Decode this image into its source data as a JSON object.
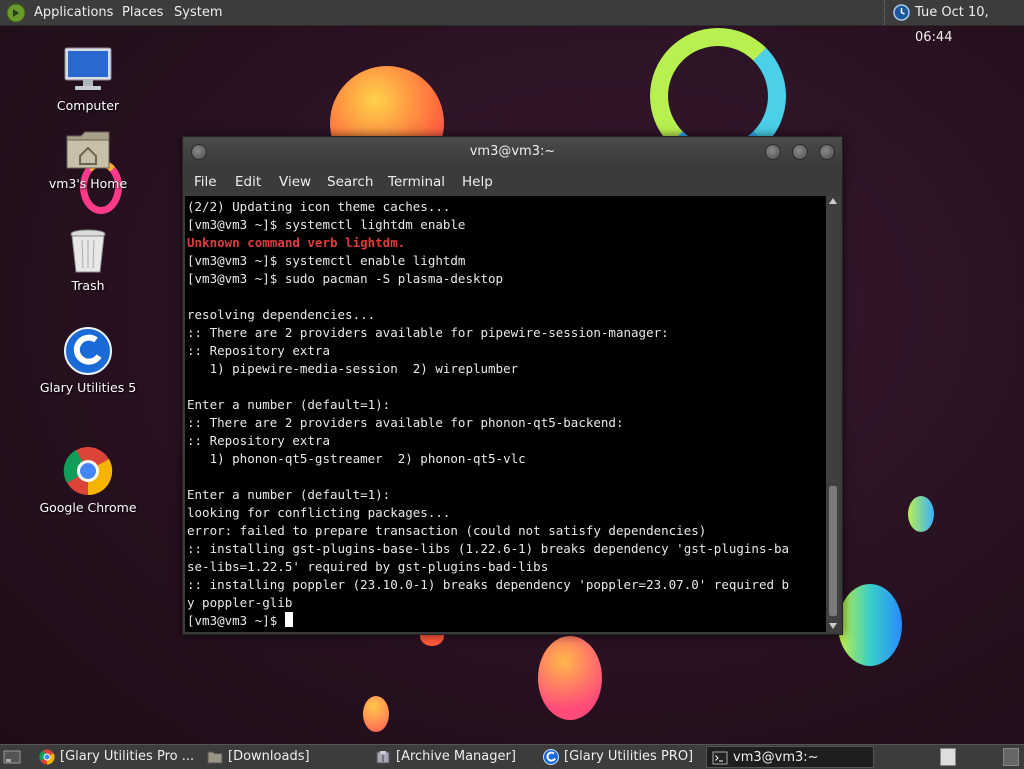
{
  "top_panel": {
    "menus": [
      "Applications",
      "Places",
      "System"
    ],
    "clock": "Tue Oct 10, 06:44"
  },
  "desktop_icons": [
    {
      "label": "Computer",
      "icon": "computer-icon"
    },
    {
      "label": "vm3's Home",
      "icon": "home-folder-icon"
    },
    {
      "label": "Trash",
      "icon": "trash-icon"
    },
    {
      "label": "Glary Utilities 5",
      "icon": "glary-utilities-icon"
    },
    {
      "label": "Google Chrome",
      "icon": "chrome-icon"
    }
  ],
  "terminal": {
    "title": "vm3@vm3:~",
    "menu": [
      "File",
      "Edit",
      "View",
      "Search",
      "Terminal",
      "Help"
    ],
    "lines": [
      {
        "text": "(2/2) Updating icon theme caches...",
        "error": false
      },
      {
        "text": "[vm3@vm3 ~]$ systemctl lightdm enable",
        "error": false
      },
      {
        "text": "Unknown command verb lightdm.",
        "error": true
      },
      {
        "text": "[vm3@vm3 ~]$ systemctl enable lightdm",
        "error": false
      },
      {
        "text": "[vm3@vm3 ~]$ sudo pacman -S plasma-desktop",
        "error": false
      },
      {
        "text": "",
        "error": false
      },
      {
        "text": "resolving dependencies...",
        "error": false
      },
      {
        "text": ":: There are 2 providers available for pipewire-session-manager:",
        "error": false
      },
      {
        "text": ":: Repository extra",
        "error": false
      },
      {
        "text": "   1) pipewire-media-session  2) wireplumber",
        "error": false
      },
      {
        "text": "",
        "error": false
      },
      {
        "text": "Enter a number (default=1):",
        "error": false
      },
      {
        "text": ":: There are 2 providers available for phonon-qt5-backend:",
        "error": false
      },
      {
        "text": ":: Repository extra",
        "error": false
      },
      {
        "text": "   1) phonon-qt5-gstreamer  2) phonon-qt5-vlc",
        "error": false
      },
      {
        "text": "",
        "error": false
      },
      {
        "text": "Enter a number (default=1):",
        "error": false
      },
      {
        "text": "looking for conflicting packages...",
        "error": false
      },
      {
        "text": "error: failed to prepare transaction (could not satisfy dependencies)",
        "error": false
      },
      {
        "text": ":: installing gst-plugins-base-libs (1.22.6-1) breaks dependency 'gst-plugins-ba",
        "error": false
      },
      {
        "text": "se-libs=1.22.5' required by gst-plugins-bad-libs",
        "error": false
      },
      {
        "text": ":: installing poppler (23.10.0-1) breaks dependency 'poppler=23.07.0' required b",
        "error": false
      },
      {
        "text": "y poppler-glib",
        "error": false
      }
    ],
    "prompt": "[vm3@vm3 ~]$ "
  },
  "taskbar": {
    "tasks": [
      {
        "label": "[Glary Utilities Pro ...",
        "icon": "chrome-icon",
        "active": false
      },
      {
        "label": "[Downloads]",
        "icon": "folder-icon",
        "active": false
      },
      {
        "label": "[Archive Manager]",
        "icon": "archive-manager-icon",
        "active": false
      },
      {
        "label": "[Glary Utilities PRO]",
        "icon": "glary-utilities-icon",
        "active": false
      },
      {
        "label": "vm3@vm3:~",
        "icon": "terminal-icon",
        "active": true
      }
    ]
  }
}
